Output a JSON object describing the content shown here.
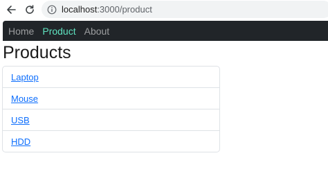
{
  "browser": {
    "url_host": "localhost",
    "url_path": ":3000/product",
    "icons": [
      "back-arrow-icon",
      "reload-icon",
      "info-icon"
    ]
  },
  "navbar": {
    "links": [
      {
        "label": "Home",
        "active": false
      },
      {
        "label": "Product",
        "active": true
      },
      {
        "label": "About",
        "active": false
      }
    ],
    "colors": {
      "background": "#212529",
      "active": "#5fe3c0",
      "inactive": "#9a9da0"
    }
  },
  "main": {
    "title": "Products",
    "items": [
      "Laptop",
      "Mouse",
      "USB",
      "HDD"
    ]
  }
}
